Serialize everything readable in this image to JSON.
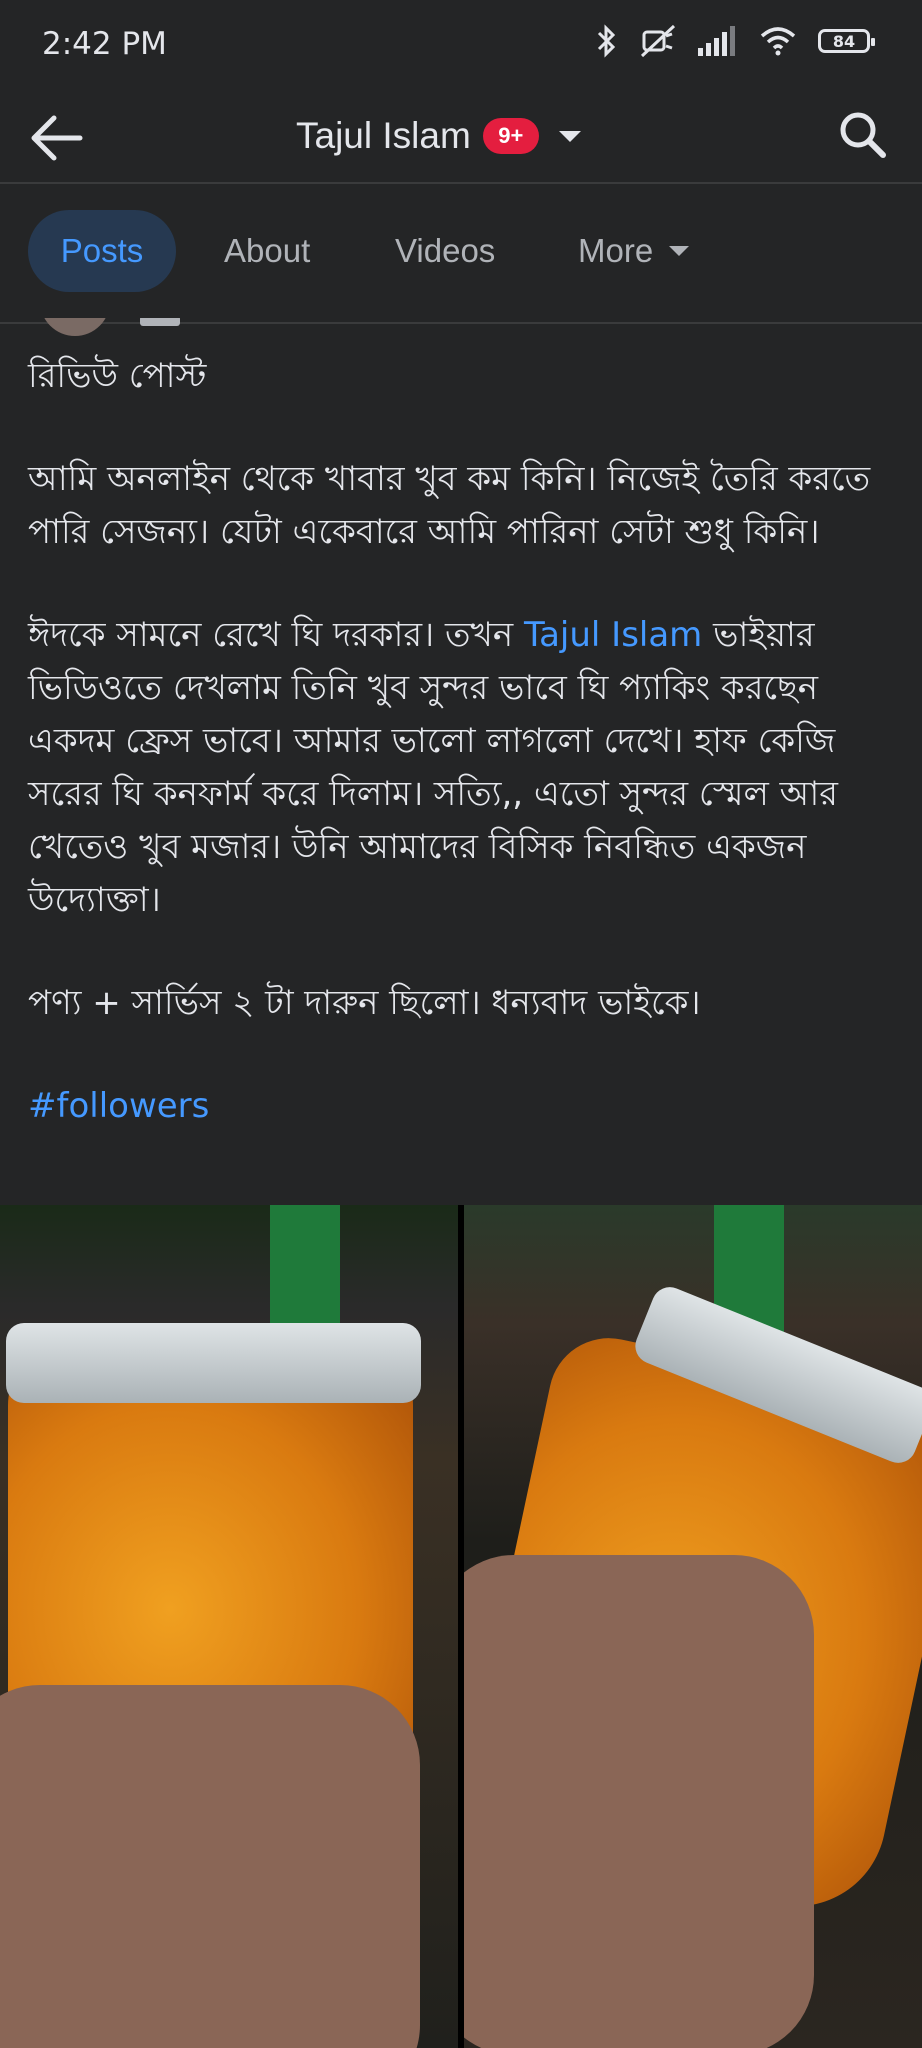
{
  "status_bar": {
    "time": "2:42 PM",
    "battery": "84"
  },
  "header": {
    "title": "Tajul Islam",
    "badge": "9+"
  },
  "tabs": [
    {
      "label": "Posts",
      "active": true
    },
    {
      "label": "About",
      "active": false
    },
    {
      "label": "Videos",
      "active": false
    },
    {
      "label": "More",
      "active": false
    }
  ],
  "post": {
    "heading": "রিভিউ পোস্ট",
    "paragraph1": "আমি অনলাইন থেকে খাবার খুব কম কিনি। নিজেই তৈরি করতে পারি সেজন্য।  যেটা একেবারে আমি পারিনা সেটা শুধু কিনি।",
    "paragraph2_before": "ঈদকে সামনে রেখে ঘি দরকার।  তখন ",
    "paragraph2_link": "Tajul Islam",
    "paragraph2_after": " ভাইয়ার ভিডিওতে দেখলাম তিনি খুব সুন্দর ভাবে ঘি প্যাকিং করছেন একদম ফ্রেস ভাবে।  আমার ভালো লাগলো দেখে।  হাফ কেজি সরের ঘি কনফার্ম করে দিলাম।  সত্যি,,  এতো সুন্দর স্মেল আর খেতেও খুব মজার।  উনি আমাদের বিসিক নিবন্ধিত একজন উদ্যোক্তা।",
    "paragraph3": "পণ্য + সার্ভিস ২ টা দারুন ছিলো।  ধন্যবাদ ভাইকে।",
    "hashtag": "#followers"
  },
  "colors": {
    "background": "#242526",
    "text": "#e4e6eb",
    "link": "#4599ff",
    "badge": "#e41e3f",
    "active_tab_bg": "#263951"
  },
  "icons": [
    "bluetooth-icon",
    "mute-icon",
    "signal-icon",
    "wifi-icon",
    "battery-icon",
    "back-arrow-icon",
    "search-icon",
    "caret-down-icon"
  ]
}
